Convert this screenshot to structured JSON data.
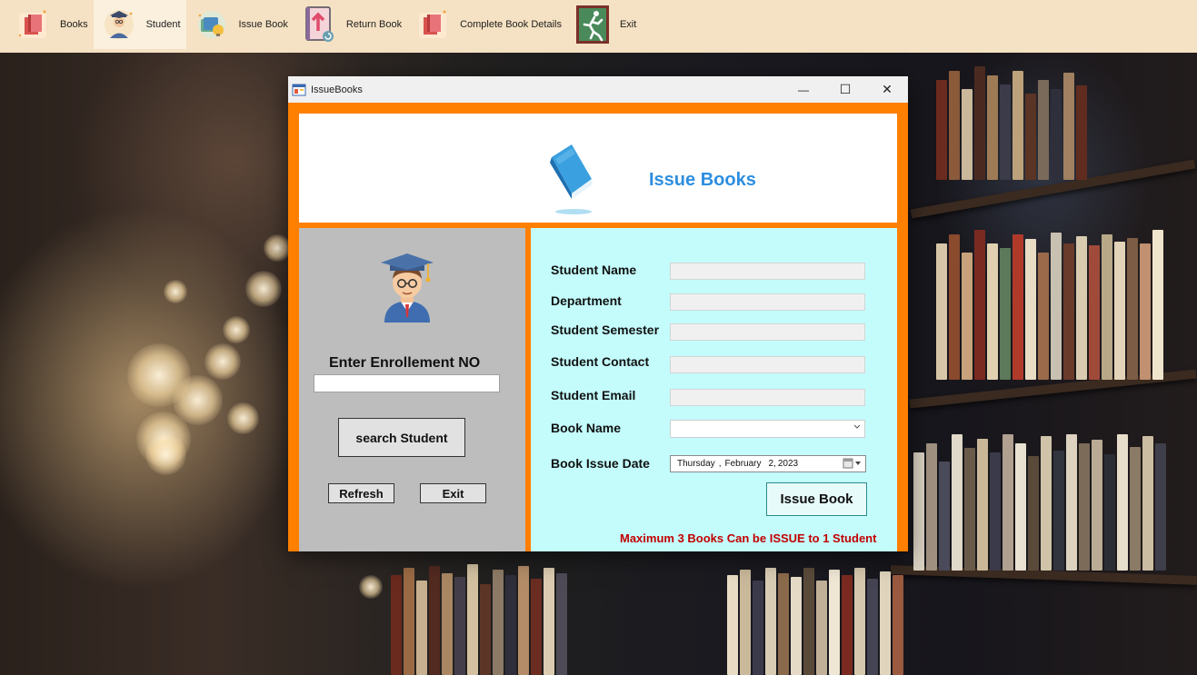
{
  "toolbar": {
    "items": [
      {
        "label": "Books",
        "icon": "books-icon"
      },
      {
        "label": "Student",
        "icon": "student-icon"
      },
      {
        "label": "Issue Book",
        "icon": "issue-book-icon"
      },
      {
        "label": "Return Book",
        "icon": "return-book-icon"
      },
      {
        "label": "Complete Book Details",
        "icon": "book-details-icon"
      },
      {
        "label": "Exit",
        "icon": "exit-icon"
      }
    ],
    "active_index": 1
  },
  "window": {
    "title": "IssueBooks",
    "minimize": "—",
    "maximize": "☐",
    "close": "✕"
  },
  "header": {
    "title": "Issue Books",
    "icon": "blue-book-icon"
  },
  "left": {
    "avatar_icon": "graduate-student-icon",
    "enroll_label": "Enter Enrollement NO",
    "enroll_value": "",
    "search_button": "search Student",
    "refresh_button": "Refresh",
    "exit_button": "Exit"
  },
  "form": {
    "student_name_label": "Student Name",
    "department_label": "Department",
    "semester_label": "Student Semester",
    "contact_label": "Student Contact",
    "email_label": "Student Email",
    "book_name_label": "Book Name",
    "issue_date_label": "Book Issue Date",
    "date": {
      "weekday": "Thursday",
      "month": "February",
      "day": "2",
      "year": "2023"
    },
    "issue_button": "Issue Book",
    "warning": "Maximum 3 Books Can be ISSUE to 1 Student"
  },
  "colors": {
    "toolbar_bg": "#f5e1c3",
    "frame_orange": "#ff7f00",
    "left_panel": "#bdbdbd",
    "right_panel": "#c4fcfc",
    "title_blue": "#2d8ee0",
    "warning_red": "#c20000"
  }
}
